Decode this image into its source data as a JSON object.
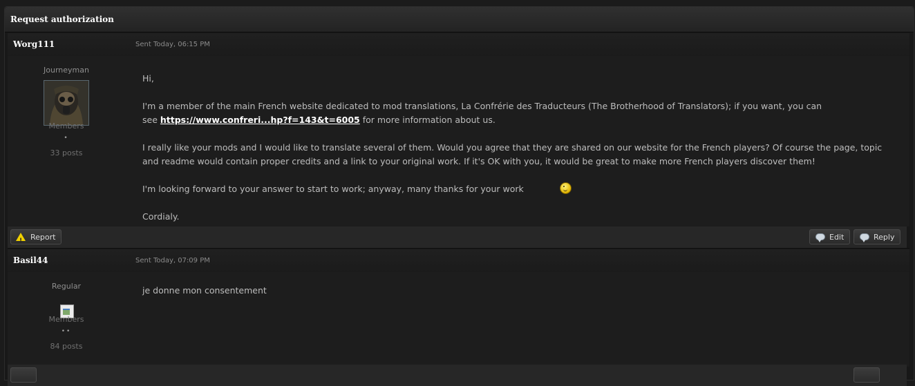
{
  "window": {
    "title": "Request authorization"
  },
  "posts": [
    {
      "author": "Worg111",
      "sent": "Sent Today, 06:15 PM",
      "rank": "Journeyman",
      "group": "Members",
      "pips": "•",
      "post_count": "33 posts",
      "message": {
        "greeting": "Hi,",
        "p1_start": "I'm a member of the main French website dedicated to mod translations, La Confrérie des Traducteurs (The Brotherhood of Translators); if you want, you can",
        "p1_see": "see ",
        "p1_link": "https://www.confreri...hp?f=143&t=6005",
        "p1_end": " for more information about us.",
        "p2_line1": "I really like your mods and I would like to translate several of them. Would you agree that they are shared on our website for the French players? Of course the page, topic",
        "p2_line2": "and readme would contain proper credits and a link to your original work. If it's OK with you, it would be great to make more French players discover them!",
        "p3": "I'm looking forward to your answer to start to work; anyway, many thanks for your work",
        "sign": "Cordialy."
      },
      "buttons": {
        "report": "Report",
        "edit": "Edit",
        "reply": "Reply"
      }
    },
    {
      "author": "Basil44",
      "sent": "Sent Today, 07:09 PM",
      "rank": "Regular",
      "group": "Members",
      "pips": "••",
      "post_count": "84 posts",
      "message": {
        "text": "je donne mon consentement"
      }
    }
  ],
  "icons": {
    "report": "warning-icon",
    "edit": "speech-bubble-icon",
    "reply": "speech-bubble-icon",
    "smiley": "wink-smiley-icon"
  }
}
